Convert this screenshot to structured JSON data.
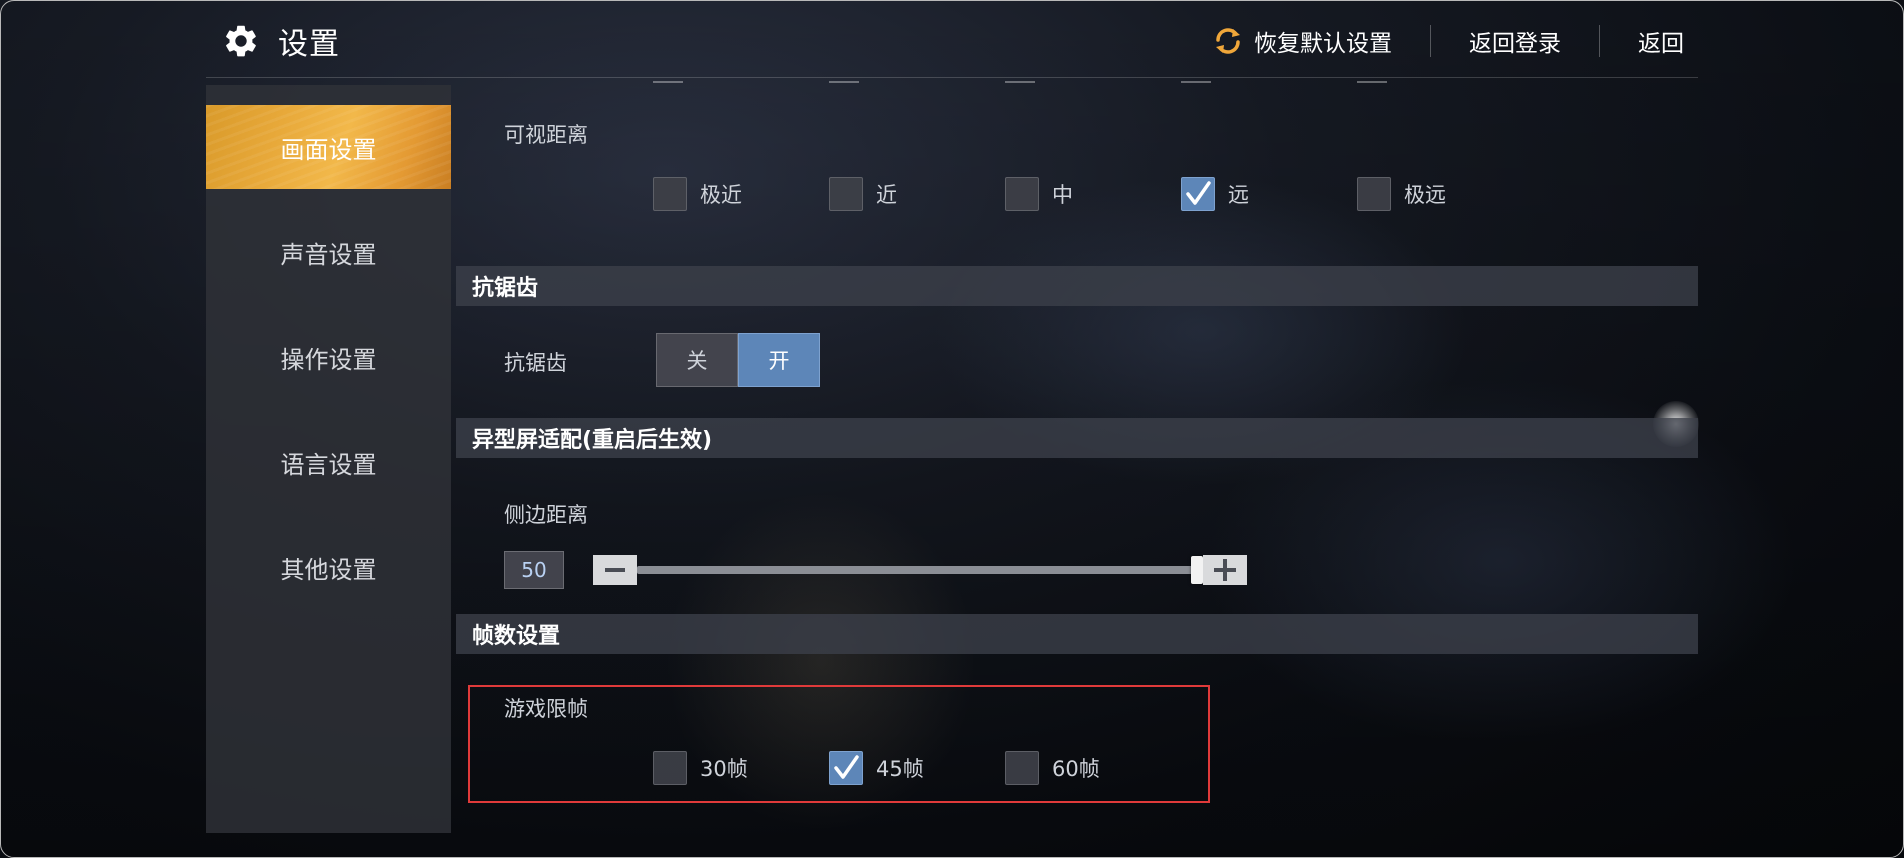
{
  "header": {
    "title": "设置",
    "restore_label": "恢复默认设置",
    "back_login_label": "返回登录",
    "back_label": "返回"
  },
  "sidebar": {
    "items": [
      {
        "label": "画面设置",
        "active": true
      },
      {
        "label": "声音设置",
        "active": false
      },
      {
        "label": "操作设置",
        "active": false
      },
      {
        "label": "语言设置",
        "active": false
      },
      {
        "label": "其他设置",
        "active": false
      }
    ]
  },
  "view_distance": {
    "label": "可视距离",
    "options": [
      {
        "label": "极近",
        "checked": false
      },
      {
        "label": "近",
        "checked": false
      },
      {
        "label": "中",
        "checked": false
      },
      {
        "label": "远",
        "checked": true
      },
      {
        "label": "极远",
        "checked": false
      }
    ]
  },
  "antialias": {
    "section_title": "抗锯齿",
    "label": "抗锯齿",
    "off_label": "关",
    "on_label": "开",
    "value": "开"
  },
  "notch": {
    "section_title": "异型屏适配(重启后生效)",
    "label": "侧边距离",
    "value": "50",
    "slider_fraction": 1.0
  },
  "fps": {
    "section_title": "帧数设置",
    "label": "游戏限帧",
    "options": [
      {
        "label": "30帧",
        "checked": false
      },
      {
        "label": "45帧",
        "checked": true
      },
      {
        "label": "60帧",
        "checked": false
      }
    ]
  },
  "colors": {
    "accent": "#5d86b8",
    "active_tab": "#e8a93a",
    "highlight": "#e03a3a"
  }
}
